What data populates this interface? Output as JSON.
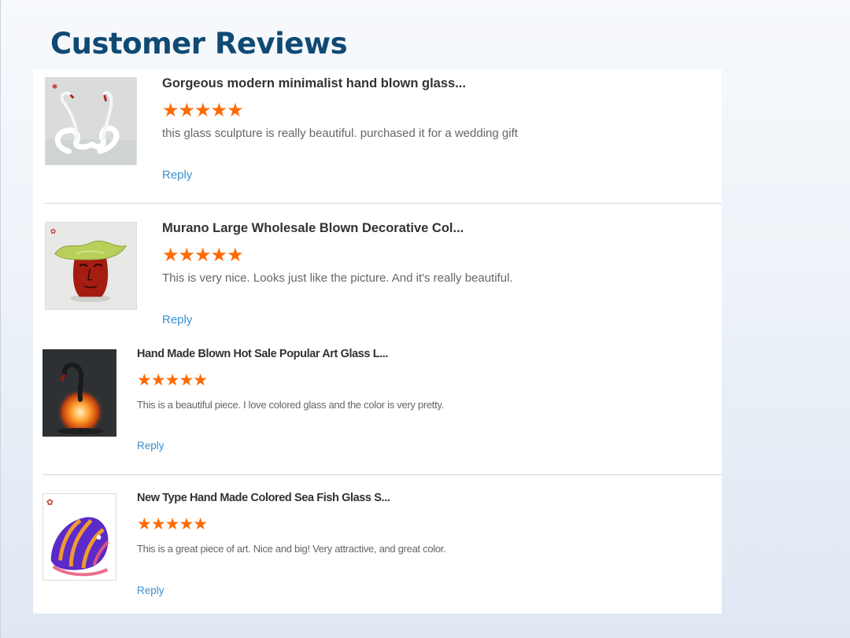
{
  "page": {
    "title": "Customer Reviews"
  },
  "colors": {
    "title": "#0f4a74",
    "star": "#ff6a00",
    "reply": "#3a8fd0"
  },
  "reviews": [
    {
      "product_title": "Gorgeous modern minimalist hand blown glass...",
      "rating": 5,
      "stars": "★★★★★",
      "text": "this glass sculpture is really beautiful. purchased it for a wedding gift",
      "reply_label": "Reply",
      "thumbnail": "glass-swans-image"
    },
    {
      "product_title": "Murano Large Wholesale Blown Decorative Col...",
      "rating": 5,
      "stars": "★★★★★",
      "text": "This is very nice. Looks just like the picture. And it's really beautiful.",
      "reply_label": "Reply",
      "thumbnail": "glass-face-vase-image"
    },
    {
      "product_title": "Hand Made Blown Hot Sale Popular Art Glass L...",
      "rating": 5,
      "stars": "★★★★★",
      "text": "This is a beautiful piece. I love colored glass and the color is very pretty.",
      "reply_label": "Reply",
      "thumbnail": "glass-swan-lamp-image"
    },
    {
      "product_title": "New Type Hand Made Colored Sea Fish Glass S...",
      "rating": 5,
      "stars": "★★★★★",
      "text": "This is a great piece of art. Nice and big! Very attractive, and great color.",
      "reply_label": "Reply",
      "thumbnail": "glass-fish-image"
    }
  ]
}
